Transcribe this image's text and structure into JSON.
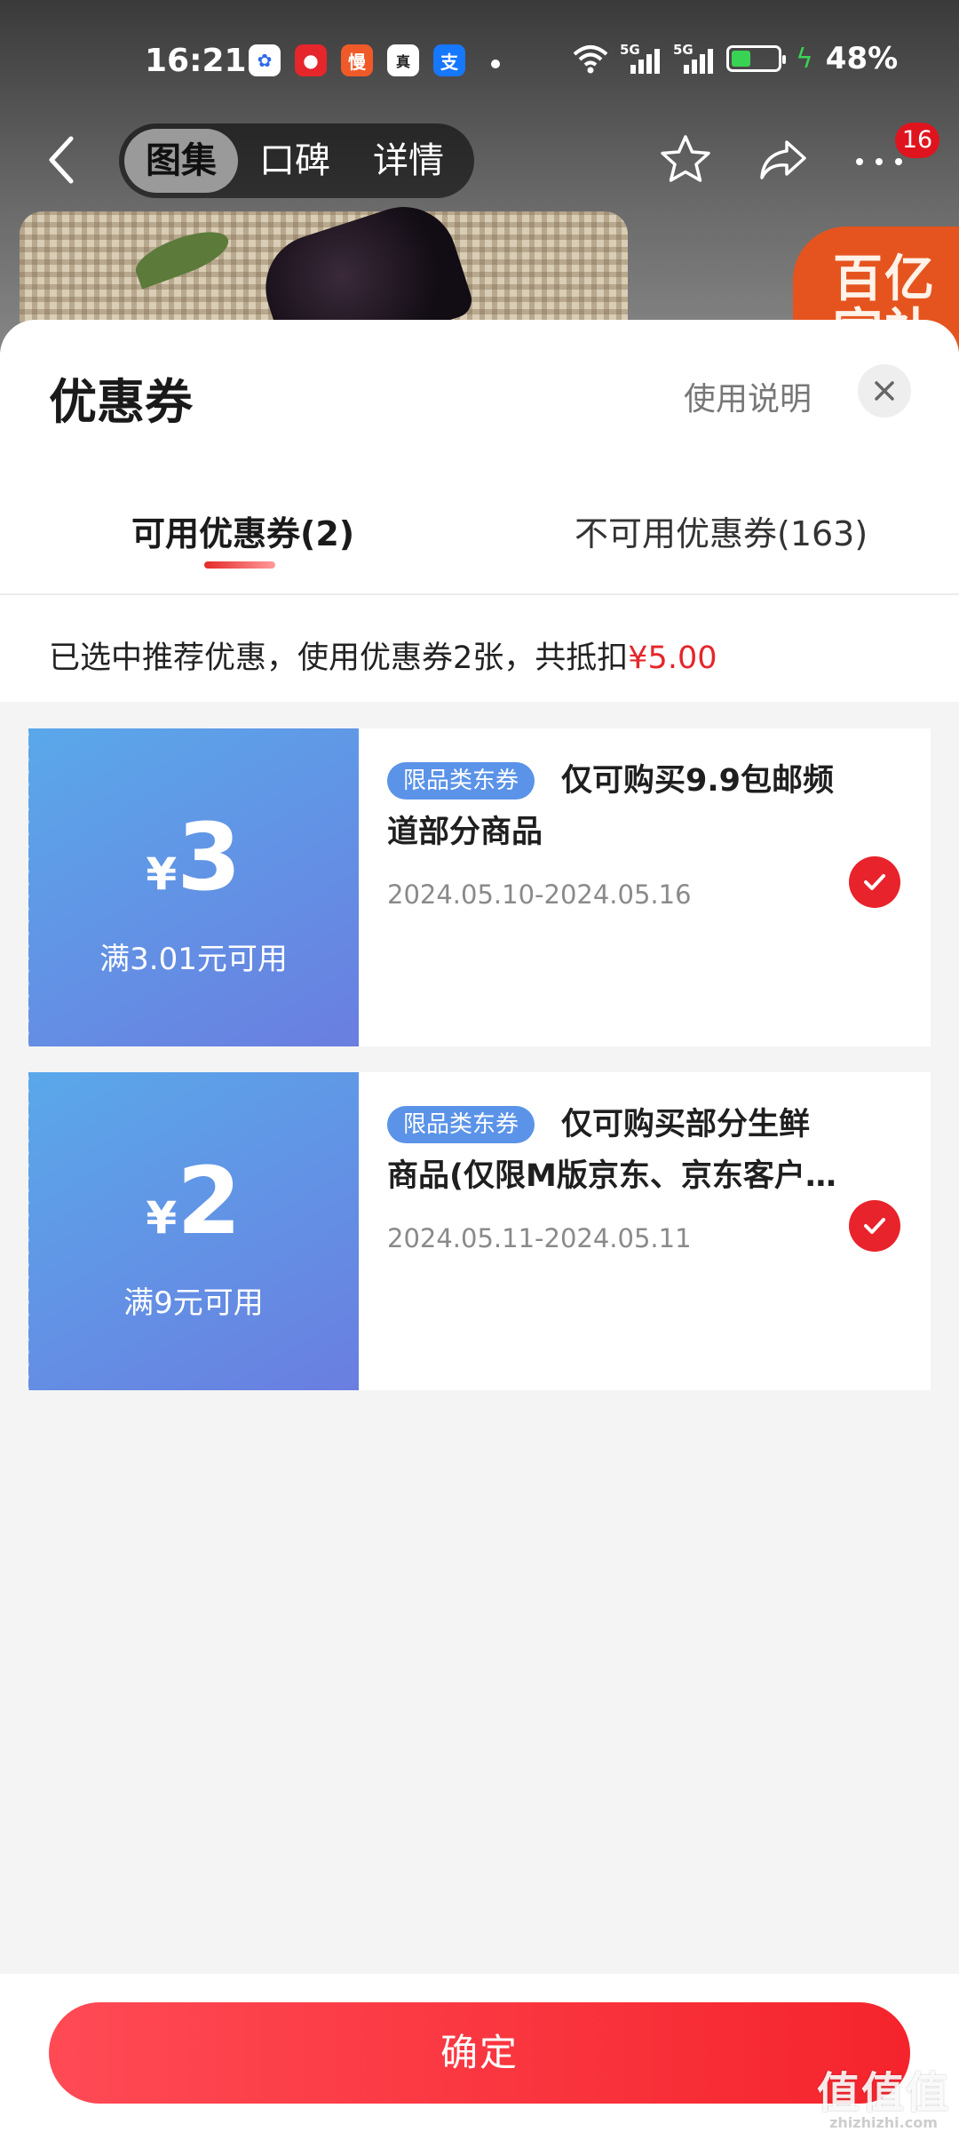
{
  "status_bar": {
    "time": "16:21",
    "apps": [
      {
        "icon": "baidu-paw-icon",
        "glyph": "✿",
        "color": "#2f6ae8"
      },
      {
        "icon": "jd-dog-icon",
        "glyph": "●",
        "color": "#e5262b"
      },
      {
        "icon": "kuaikan-icon",
        "glyph": "慢",
        "color": "#f05a28"
      },
      {
        "icon": "realme-icon",
        "glyph": "真",
        "color": "#ffffff"
      },
      {
        "icon": "alipay-icon",
        "glyph": "支",
        "color": "#1677ff"
      }
    ],
    "net_label_1": "5G",
    "net_label_2": "5G",
    "battery_level": 0.48,
    "battery_text": "48%"
  },
  "background": {
    "promo_text": "百亿\n官补"
  },
  "nav": {
    "tabs": [
      "图集",
      "口碑",
      "详情"
    ],
    "active_tab": 0,
    "badge_count": "16"
  },
  "sheet": {
    "title": "优惠券",
    "usage_link": "使用说明",
    "tab_available": "可用优惠券(2)",
    "tab_unavailable": "不可用优惠券(163)",
    "summary_prefix": "已选中推荐优惠，使用优惠券2张，共抵扣",
    "summary_amount": "¥5.00"
  },
  "coupons": [
    {
      "currency": "¥",
      "amount": "3",
      "condition": "满3.01元可用",
      "tag": "限品类东券",
      "description": "仅可购买9.9包邮频道部分商品",
      "date_range": "2024.05.10-2024.05.16",
      "selected": true
    },
    {
      "currency": "¥",
      "amount": "2",
      "condition": "满9元可用",
      "tag": "限品类东券",
      "description": "仅可购买部分生鲜商品(仅限M版京东、京东客户端...",
      "date_range": "2024.05.11-2024.05.11",
      "selected": true
    }
  ],
  "footer": {
    "confirm_label": "确定"
  },
  "watermark": {
    "main": "值值值",
    "sub": "zhizhizhi.com"
  },
  "colors": {
    "accent_red": "#e5262b",
    "coupon_blue_start": "#5aa8ea",
    "coupon_blue_end": "#6a7ee0"
  }
}
